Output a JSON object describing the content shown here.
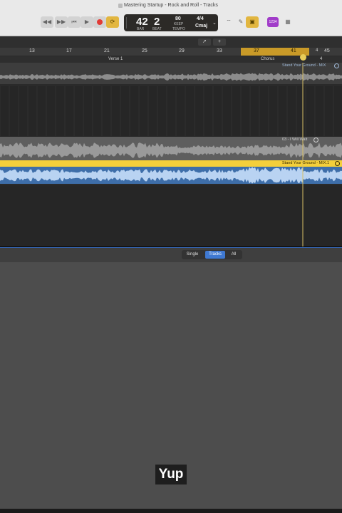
{
  "window": {
    "title": "Mastering Startup - Rock and Roll - Tracks"
  },
  "transport": {
    "rewind_icon": "rewind-icon",
    "forward_icon": "fast-forward-icon",
    "to_start_icon": "skip-to-start-icon",
    "play_icon": "play-icon",
    "record_icon": "record-icon",
    "cycle_icon": "cycle-icon"
  },
  "lcd": {
    "bar": "42",
    "beat": "2",
    "bar_label": "BAR",
    "beat_label": "BEAT",
    "tempo": "80",
    "tempo_label": "KEEP",
    "tempo_sub": "TEMPO",
    "signature": "4/4",
    "key": "Cmaj"
  },
  "right_toolbar": {
    "badge": "1234"
  },
  "ruler": {
    "bars": [
      "13",
      "17",
      "21",
      "25",
      "29",
      "33",
      "37",
      "41",
      "45"
    ],
    "extra_marks": [
      "4",
      "4"
    ],
    "sections": [
      "Verse 1",
      "Chorus"
    ]
  },
  "regions": {
    "track1_name": "Stand Your Ground - MIX",
    "track2_name": "03 - I Will Wait",
    "track3_name": "Stand Your Ground - MIX.1"
  },
  "view_selector": {
    "options": [
      "Single",
      "Tracks",
      "All"
    ],
    "selected": "Tracks"
  },
  "caption": {
    "text": "Yup"
  },
  "colors": {
    "cycle": "#e2b640",
    "region_selected": "#f4cf3b",
    "waveform_blue": "#3e6ea9",
    "waveform_gray": "#8c8c8c",
    "playhead": "#d8c066"
  }
}
